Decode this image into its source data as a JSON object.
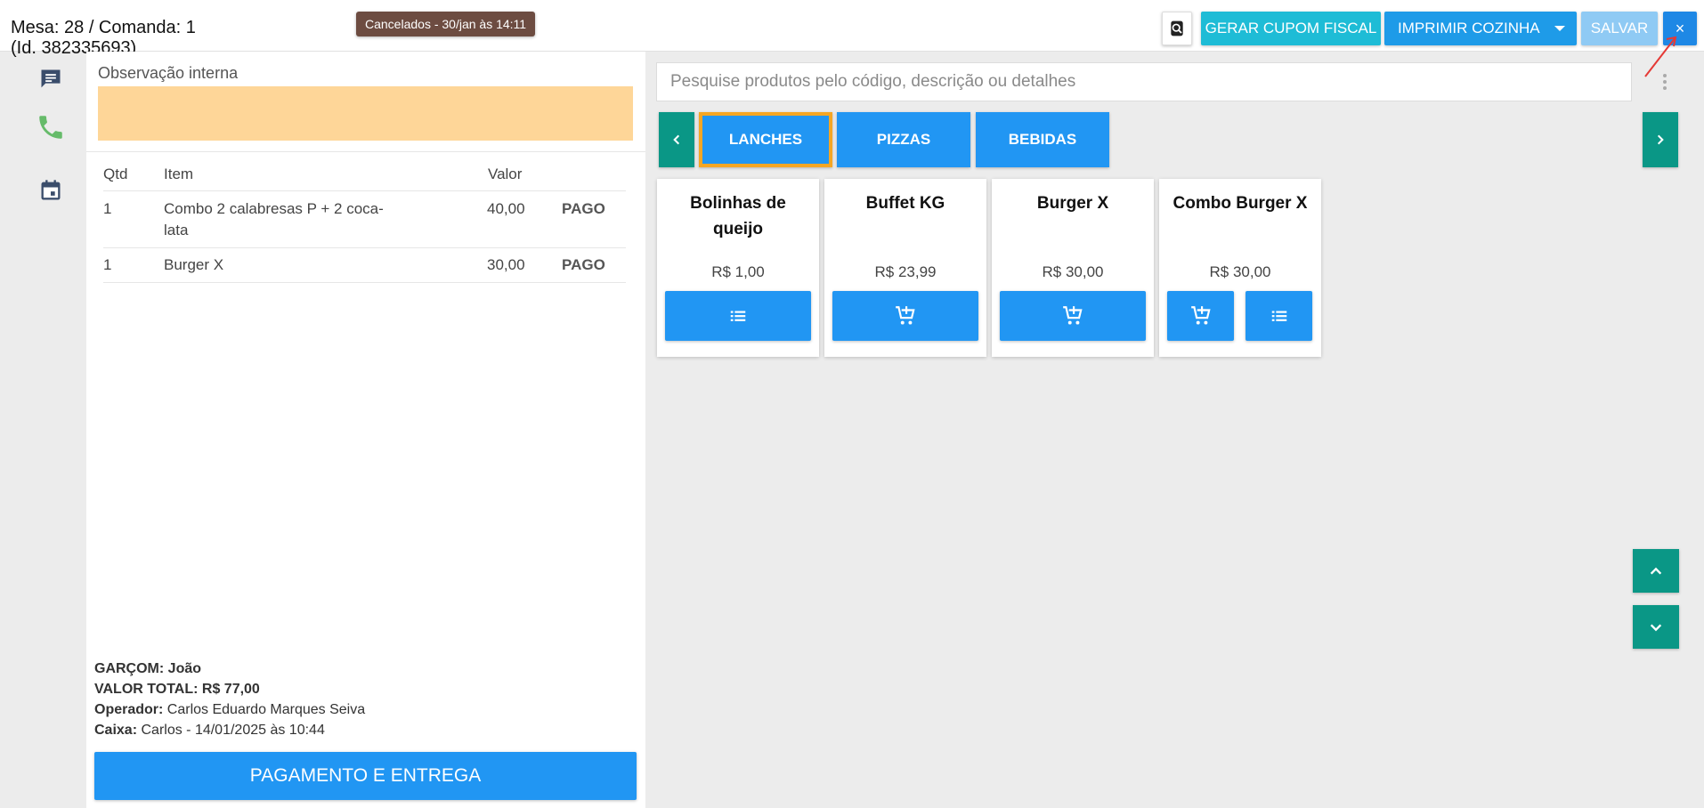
{
  "header": {
    "title_line1": "Mesa: 28 / Comanda: 1",
    "title_line2": "(Id. 382335693)",
    "toast": "Cancelados - 30/jan às 14:11",
    "buttons": {
      "cupom": "GERAR CUPOM FISCAL",
      "imprimir": "IMPRIMIR COZINHA",
      "salvar": "SALVAR",
      "close": "×"
    }
  },
  "sidebar": {
    "icons": [
      "chat-icon",
      "phone-icon",
      "calendar-icon"
    ]
  },
  "left": {
    "obs_label": "Observação interna",
    "table": {
      "headers": {
        "qtd": "Qtd",
        "item": "Item",
        "valor": "Valor"
      },
      "rows": [
        {
          "qtd": "1",
          "item": "Combo 2 calabresas P + 2 coca-lata",
          "valor": "40,00",
          "status": "PAGO"
        },
        {
          "qtd": "1",
          "item": "Burger X",
          "valor": "30,00",
          "status": "PAGO"
        }
      ]
    },
    "totals": {
      "garcom_label": "GARÇOM:",
      "garcom_value": "João",
      "total_label": "VALOR TOTAL:",
      "total_value": "R$ 77,00",
      "operador_label": "Operador:",
      "operador_value": "Carlos Eduardo Marques Seiva",
      "caixa_label": "Caixa:",
      "caixa_value": "Carlos - 14/01/2025 às 10:44"
    },
    "pagamento_button": "PAGAMENTO E ENTREGA"
  },
  "right": {
    "search_placeholder": "Pesquise produtos pelo código, descrição ou detalhes",
    "categories": [
      "LANCHES",
      "PIZZAS",
      "BEBIDAS"
    ],
    "active_category": "LANCHES",
    "products": [
      {
        "name": "Bolinhas de queijo",
        "price": "R$ 1,00"
      },
      {
        "name": "Buffet KG",
        "price": "R$ 23,99"
      },
      {
        "name": "Burger X",
        "price": "R$ 30,00"
      },
      {
        "name": "Combo Burger X",
        "price": "R$ 30,00"
      }
    ]
  },
  "colors": {
    "primary": "#2196f3",
    "teal": "#0a9786",
    "cyan": "#1ebcd6",
    "observation": "#fed698",
    "toast": "#6d4c41",
    "active_border": "#f5a623"
  }
}
